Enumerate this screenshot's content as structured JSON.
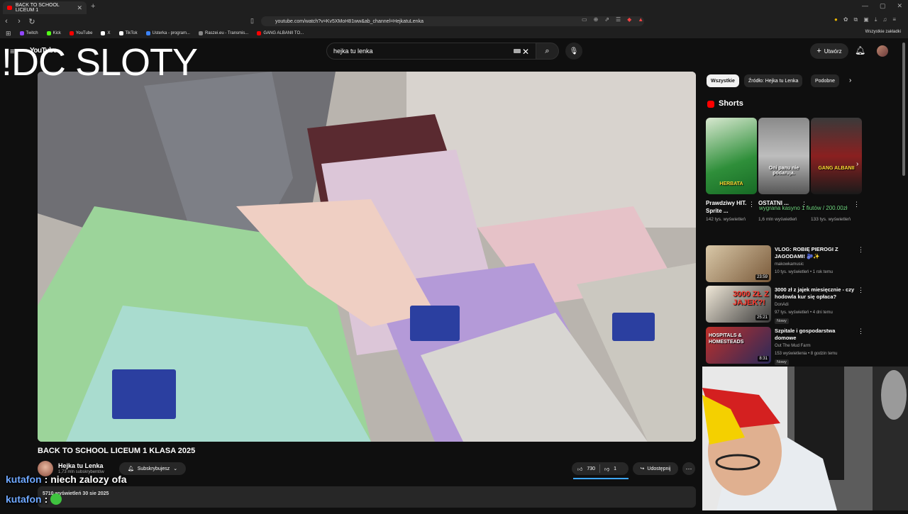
{
  "browser": {
    "tab_title": "BACK TO SCHOOL LICEUM 1",
    "new_tab": "+",
    "url": "youtube.com/watch?v=Kv5XMoH81ww&ab_channel=HejkatuLenka",
    "bookmarks": [
      {
        "label": "Twitch",
        "color": "#9146ff"
      },
      {
        "label": "Kick",
        "color": "#53fc18"
      },
      {
        "label": "YouTube",
        "color": "#ff0000"
      },
      {
        "label": "X",
        "color": "#ffffff"
      },
      {
        "label": "TikTok",
        "color": "#ffffff"
      },
      {
        "label": "Usterka - program...",
        "color": "#3b82f6"
      },
      {
        "label": "Raszei.eu - Transmis...",
        "color": "#888888"
      },
      {
        "label": "GANG ALBANII TO...",
        "color": "#ff0000"
      }
    ],
    "all_bookmarks": "Wszystkie zakładki"
  },
  "youtube": {
    "logo": "YouTube",
    "search_value": "hejka tu lenka",
    "create_label": "Utwórz"
  },
  "overlay": {
    "title": "!DC SLOTY"
  },
  "video": {
    "title": "BACK TO SCHOOL LICEUM 1 KLASA 2025",
    "channel": "Hejka tu Lenka",
    "subscribers": "1,73 mln subskrybentów",
    "subscribe_label": "Subskrybujesz",
    "likes": "730",
    "dislikes": "1",
    "share_label": "Udostępnij",
    "description_peek": "5710 wyświetleń  30 sie 2025"
  },
  "chat": [
    {
      "user": "kutafon",
      "message": "niech zalozy ofa"
    },
    {
      "user": "kutafon",
      "message": ""
    }
  ],
  "sidebar": {
    "chips": [
      "Wszystkie",
      "Źródło: Hejka tu Lenka",
      "Podobne"
    ],
    "shorts_heading": "Shorts",
    "shorts": [
      {
        "caption": "HERBATA",
        "title": "Prawdziwy HIT. Sprite ...",
        "views": "142 tys. wyświetleń"
      },
      {
        "caption": "Oni panu nie podaruja.",
        "title": "OSTATNI ...",
        "views": "1,6 mln wyświetleń"
      },
      {
        "caption": "GANG ALBANII",
        "title": "",
        "views": "133 tys. wyświetleń"
      }
    ],
    "stream_alert": "wygrana kasyno 1 fiutów / 200.00zł",
    "recommended": [
      {
        "title": "VLOG: ROBIĘ PIEROGI Z JAGODAMI! 🫐✨",
        "channel": "makowkamusic",
        "meta": "10 tys. wyświetleń • 1 rok temu",
        "duration": "23:59",
        "badge": ""
      },
      {
        "title": "3000 zł z jajek miesięcznie - czy hodowla kur się opłaca?",
        "channel": "DonAdi",
        "meta": "97 tys. wyświetleń • 4 dni temu",
        "duration": "25:21",
        "badge": "Nowy",
        "thumb_text": "3000 ZŁ Z JAJEK?!"
      },
      {
        "title": "Szpitale i gospodarstwa domowe",
        "channel": "Out The Mud Farm",
        "meta": "153 wyświetlenia • 8 godzin temu",
        "duration": "8:31",
        "badge": "Nowy",
        "thumb_text": "HOSPITALS & HOMESTEADS"
      }
    ]
  }
}
